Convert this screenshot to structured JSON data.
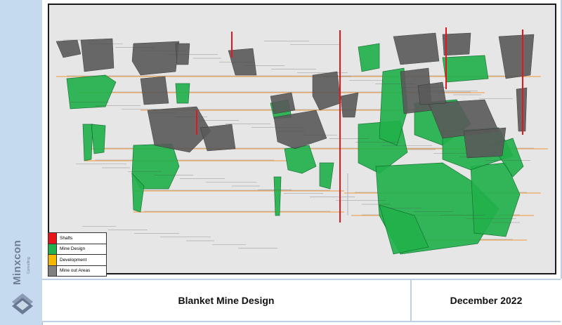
{
  "brand": {
    "name": "Minxcon",
    "tagline": "Consulting"
  },
  "title": "Blanket Mine Design",
  "date": "December 2022",
  "legend": [
    {
      "label": "Shafts",
      "color": "#e8141c"
    },
    {
      "label": "Mine Design",
      "color": "#22b14c"
    },
    {
      "label": "Development",
      "color": "#f5b800"
    },
    {
      "label": "Mine out Areas",
      "color": "#808080"
    }
  ],
  "colors": {
    "shaft": "#e8141c",
    "mine_design": "#22b14c",
    "development": "#f08a1c",
    "mined_out": "#5a5a5a",
    "background": "#e6e6e6"
  }
}
